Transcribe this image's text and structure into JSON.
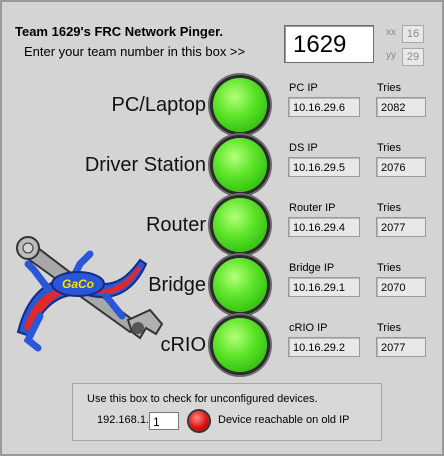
{
  "header": {
    "title": "Team 1629's FRC Network Pinger.",
    "subtitle": "Enter your team number in this box >>",
    "team_number": "1629",
    "xx_label": "xx",
    "xx_value": "16",
    "yy_label": "yy",
    "yy_value": "29"
  },
  "devices": [
    {
      "label": "PC/Laptop",
      "ip_label": "PC IP",
      "ip": "10.16.29.6",
      "tries_label": "Tries",
      "tries": "2082"
    },
    {
      "label": "Driver Station",
      "ip_label": "DS IP",
      "ip": "10.16.29.5",
      "tries_label": "Tries",
      "tries": "2076"
    },
    {
      "label": "Router",
      "ip_label": "Router IP",
      "ip": "10.16.29.4",
      "tries_label": "Tries",
      "tries": "2077"
    },
    {
      "label": "Bridge",
      "ip_label": "Bridge IP",
      "ip": "10.16.29.1",
      "tries_label": "Tries",
      "tries": "2070"
    },
    {
      "label": "cRIO",
      "ip_label": "cRIO IP",
      "ip": "10.16.29.2",
      "tries_label": "Tries",
      "tries": "2077"
    }
  ],
  "unconfigured": {
    "instruction": "Use this box to check for unconfigured devices.",
    "ip_prefix": "192.168.1.",
    "ip_suffix": "1",
    "status": "Device reachable on old IP"
  },
  "logo": {
    "text": "GaCo"
  },
  "colors": {
    "led_on": "#4fdc20",
    "led_alert": "#e01010",
    "panel_bg": "#d4d4d4"
  }
}
